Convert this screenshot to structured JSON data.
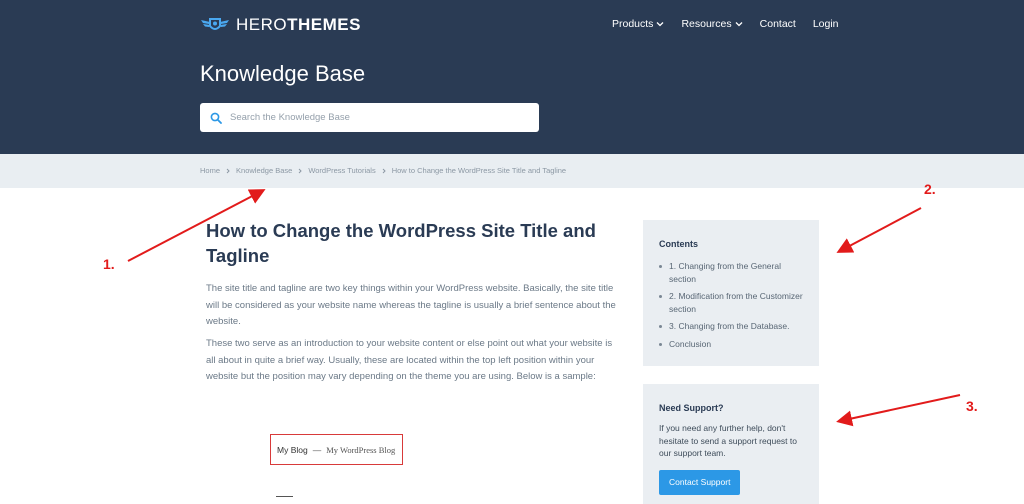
{
  "brand": {
    "part1": "HERO",
    "part2": "THEMES"
  },
  "nav": [
    {
      "label": "Products",
      "has_dropdown": true
    },
    {
      "label": "Resources",
      "has_dropdown": true
    },
    {
      "label": "Contact",
      "has_dropdown": false
    },
    {
      "label": "Login",
      "has_dropdown": false
    }
  ],
  "header": {
    "title": "Knowledge Base"
  },
  "search": {
    "placeholder": "Search the Knowledge Base",
    "value": ""
  },
  "breadcrumb": [
    "Home",
    "Knowledge Base",
    "WordPress Tutorials",
    "How to Change the WordPress Site Title and Tagline"
  ],
  "article": {
    "title": "How to Change the WordPress Site Title and Tagline",
    "paragraphs": [
      "The site title and tagline are two key things within your WordPress website. Basically, the site title will be considered as your website name whereas the tagline is usually a brief sentence about the website.",
      "These two serve as an introduction to your website content or else point out what your website is all about in quite a brief way. Usually, these are located within the top left position within your website but the position may vary depending on the theme you are using. Below is a sample:"
    ],
    "sample": {
      "site_title": "My Blog",
      "separator": "—",
      "tagline": "My WordPress Blog"
    }
  },
  "contents": {
    "heading": "Contents",
    "items": [
      "1. Changing from the General section",
      "2. Modification from the Customizer section",
      "3. Changing from the Database.",
      "Conclusion"
    ]
  },
  "support": {
    "heading": "Need Support?",
    "text": "If you need any further help, don't hesitate to send a support request to our support team.",
    "button_label": "Contact Support"
  },
  "annotations": [
    "1.",
    "2.",
    "3."
  ],
  "colors": {
    "header_bg": "#2a3b54",
    "breadcrumb_bg": "#e9eef2",
    "accent": "#2c98e6",
    "annotation": "#e21b1b",
    "panel_bg": "#eaeef2"
  }
}
